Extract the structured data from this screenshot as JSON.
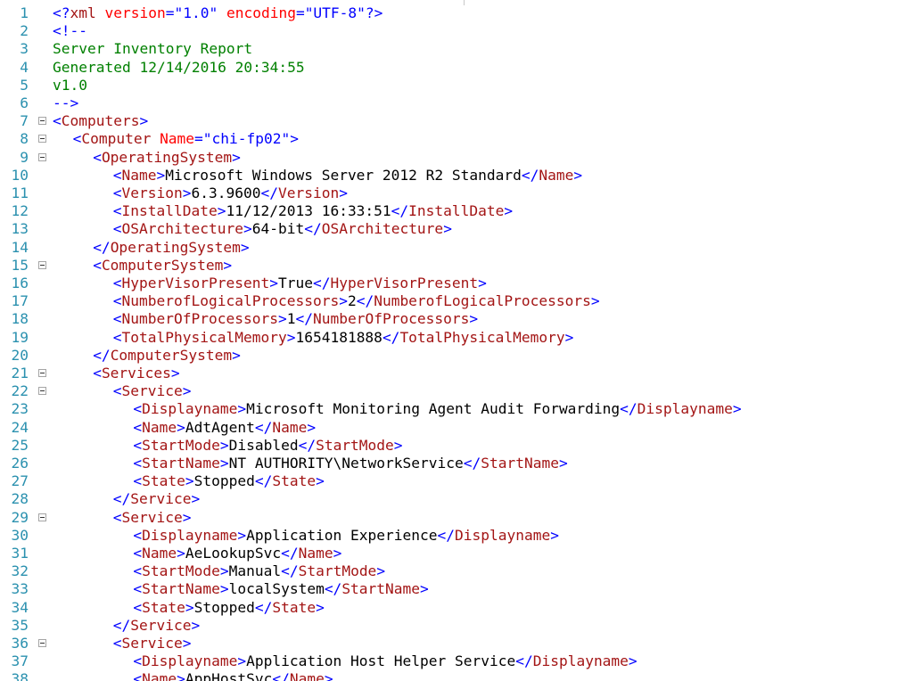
{
  "editor": {
    "colors": {
      "line_numbers": "#2b91af",
      "bracket": "#0000ff",
      "tag": "#a31515",
      "attribute": "#ff0000",
      "value": "#0000ff",
      "comment": "#008000",
      "text": "#000000"
    },
    "lines": [
      {
        "n": "1",
        "fold": false,
        "indent": 0,
        "tokens": [
          [
            "punct",
            "<?"
          ],
          [
            "tag",
            "xml"
          ],
          [
            "text",
            " "
          ],
          [
            "attr",
            "version"
          ],
          [
            "punct",
            "="
          ],
          [
            "value",
            "\"1.0\""
          ],
          [
            "text",
            " "
          ],
          [
            "attr",
            "encoding"
          ],
          [
            "punct",
            "="
          ],
          [
            "value",
            "\"UTF-8\""
          ],
          [
            "punct",
            "?>"
          ]
        ]
      },
      {
        "n": "2",
        "fold": false,
        "indent": 0,
        "tokens": [
          [
            "punct",
            "<!--"
          ]
        ]
      },
      {
        "n": "3",
        "fold": false,
        "indent": 0,
        "tokens": [
          [
            "comment",
            "Server Inventory Report"
          ]
        ]
      },
      {
        "n": "4",
        "fold": false,
        "indent": 0,
        "tokens": [
          [
            "comment",
            "Generated 12/14/2016 20:34:55"
          ]
        ]
      },
      {
        "n": "5",
        "fold": false,
        "indent": 0,
        "tokens": [
          [
            "comment",
            "v1.0"
          ]
        ]
      },
      {
        "n": "6",
        "fold": false,
        "indent": 0,
        "tokens": [
          [
            "punct",
            "-->"
          ]
        ]
      },
      {
        "n": "7",
        "fold": true,
        "indent": 0,
        "tokens": [
          [
            "bracket",
            "<"
          ],
          [
            "tag",
            "Computers"
          ],
          [
            "bracket",
            ">"
          ]
        ]
      },
      {
        "n": "8",
        "fold": true,
        "indent": 1,
        "tokens": [
          [
            "bracket",
            "<"
          ],
          [
            "tag",
            "Computer"
          ],
          [
            "text",
            " "
          ],
          [
            "attr",
            "Name"
          ],
          [
            "punct",
            "="
          ],
          [
            "value",
            "\"chi-fp02\""
          ],
          [
            "bracket",
            ">"
          ]
        ]
      },
      {
        "n": "9",
        "fold": true,
        "indent": 2,
        "tokens": [
          [
            "bracket",
            "<"
          ],
          [
            "tag",
            "OperatingSystem"
          ],
          [
            "bracket",
            ">"
          ]
        ]
      },
      {
        "n": "10",
        "fold": false,
        "indent": 3,
        "tokens": [
          [
            "bracket",
            "<"
          ],
          [
            "tag",
            "Name"
          ],
          [
            "bracket",
            ">"
          ],
          [
            "text",
            "Microsoft Windows Server 2012 R2 Standard"
          ],
          [
            "bracket",
            "</"
          ],
          [
            "tag",
            "Name"
          ],
          [
            "bracket",
            ">"
          ]
        ]
      },
      {
        "n": "11",
        "fold": false,
        "indent": 3,
        "tokens": [
          [
            "bracket",
            "<"
          ],
          [
            "tag",
            "Version"
          ],
          [
            "bracket",
            ">"
          ],
          [
            "text",
            "6.3.9600"
          ],
          [
            "bracket",
            "</"
          ],
          [
            "tag",
            "Version"
          ],
          [
            "bracket",
            ">"
          ]
        ]
      },
      {
        "n": "12",
        "fold": false,
        "indent": 3,
        "tokens": [
          [
            "bracket",
            "<"
          ],
          [
            "tag",
            "InstallDate"
          ],
          [
            "bracket",
            ">"
          ],
          [
            "text",
            "11/12/2013 16:33:51"
          ],
          [
            "bracket",
            "</"
          ],
          [
            "tag",
            "InstallDate"
          ],
          [
            "bracket",
            ">"
          ]
        ]
      },
      {
        "n": "13",
        "fold": false,
        "indent": 3,
        "tokens": [
          [
            "bracket",
            "<"
          ],
          [
            "tag",
            "OSArchitecture"
          ],
          [
            "bracket",
            ">"
          ],
          [
            "text",
            "64-bit"
          ],
          [
            "bracket",
            "</"
          ],
          [
            "tag",
            "OSArchitecture"
          ],
          [
            "bracket",
            ">"
          ]
        ]
      },
      {
        "n": "14",
        "fold": false,
        "indent": 2,
        "tokens": [
          [
            "bracket",
            "</"
          ],
          [
            "tag",
            "OperatingSystem"
          ],
          [
            "bracket",
            ">"
          ]
        ]
      },
      {
        "n": "15",
        "fold": true,
        "indent": 2,
        "tokens": [
          [
            "bracket",
            "<"
          ],
          [
            "tag",
            "ComputerSystem"
          ],
          [
            "bracket",
            ">"
          ]
        ]
      },
      {
        "n": "16",
        "fold": false,
        "indent": 3,
        "tokens": [
          [
            "bracket",
            "<"
          ],
          [
            "tag",
            "HyperVisorPresent"
          ],
          [
            "bracket",
            ">"
          ],
          [
            "text",
            "True"
          ],
          [
            "bracket",
            "</"
          ],
          [
            "tag",
            "HyperVisorPresent"
          ],
          [
            "bracket",
            ">"
          ]
        ]
      },
      {
        "n": "17",
        "fold": false,
        "indent": 3,
        "tokens": [
          [
            "bracket",
            "<"
          ],
          [
            "tag",
            "NumberofLogicalProcessors"
          ],
          [
            "bracket",
            ">"
          ],
          [
            "text",
            "2"
          ],
          [
            "bracket",
            "</"
          ],
          [
            "tag",
            "NumberofLogicalProcessors"
          ],
          [
            "bracket",
            ">"
          ]
        ]
      },
      {
        "n": "18",
        "fold": false,
        "indent": 3,
        "tokens": [
          [
            "bracket",
            "<"
          ],
          [
            "tag",
            "NumberOfProcessors"
          ],
          [
            "bracket",
            ">"
          ],
          [
            "text",
            "1"
          ],
          [
            "bracket",
            "</"
          ],
          [
            "tag",
            "NumberOfProcessors"
          ],
          [
            "bracket",
            ">"
          ]
        ]
      },
      {
        "n": "19",
        "fold": false,
        "indent": 3,
        "tokens": [
          [
            "bracket",
            "<"
          ],
          [
            "tag",
            "TotalPhysicalMemory"
          ],
          [
            "bracket",
            ">"
          ],
          [
            "text",
            "1654181888"
          ],
          [
            "bracket",
            "</"
          ],
          [
            "tag",
            "TotalPhysicalMemory"
          ],
          [
            "bracket",
            ">"
          ]
        ]
      },
      {
        "n": "20",
        "fold": false,
        "indent": 2,
        "tokens": [
          [
            "bracket",
            "</"
          ],
          [
            "tag",
            "ComputerSystem"
          ],
          [
            "bracket",
            ">"
          ]
        ]
      },
      {
        "n": "21",
        "fold": true,
        "indent": 2,
        "tokens": [
          [
            "bracket",
            "<"
          ],
          [
            "tag",
            "Services"
          ],
          [
            "bracket",
            ">"
          ]
        ]
      },
      {
        "n": "22",
        "fold": true,
        "indent": 3,
        "tokens": [
          [
            "bracket",
            "<"
          ],
          [
            "tag",
            "Service"
          ],
          [
            "bracket",
            ">"
          ]
        ]
      },
      {
        "n": "23",
        "fold": false,
        "indent": 4,
        "tokens": [
          [
            "bracket",
            "<"
          ],
          [
            "tag",
            "Displayname"
          ],
          [
            "bracket",
            ">"
          ],
          [
            "text",
            "Microsoft Monitoring Agent Audit Forwarding"
          ],
          [
            "bracket",
            "</"
          ],
          [
            "tag",
            "Displayname"
          ],
          [
            "bracket",
            ">"
          ]
        ]
      },
      {
        "n": "24",
        "fold": false,
        "indent": 4,
        "tokens": [
          [
            "bracket",
            "<"
          ],
          [
            "tag",
            "Name"
          ],
          [
            "bracket",
            ">"
          ],
          [
            "text",
            "AdtAgent"
          ],
          [
            "bracket",
            "</"
          ],
          [
            "tag",
            "Name"
          ],
          [
            "bracket",
            ">"
          ]
        ]
      },
      {
        "n": "25",
        "fold": false,
        "indent": 4,
        "tokens": [
          [
            "bracket",
            "<"
          ],
          [
            "tag",
            "StartMode"
          ],
          [
            "bracket",
            ">"
          ],
          [
            "text",
            "Disabled"
          ],
          [
            "bracket",
            "</"
          ],
          [
            "tag",
            "StartMode"
          ],
          [
            "bracket",
            ">"
          ]
        ]
      },
      {
        "n": "26",
        "fold": false,
        "indent": 4,
        "tokens": [
          [
            "bracket",
            "<"
          ],
          [
            "tag",
            "StartName"
          ],
          [
            "bracket",
            ">"
          ],
          [
            "text",
            "NT AUTHORITY\\NetworkService"
          ],
          [
            "bracket",
            "</"
          ],
          [
            "tag",
            "StartName"
          ],
          [
            "bracket",
            ">"
          ]
        ]
      },
      {
        "n": "27",
        "fold": false,
        "indent": 4,
        "tokens": [
          [
            "bracket",
            "<"
          ],
          [
            "tag",
            "State"
          ],
          [
            "bracket",
            ">"
          ],
          [
            "text",
            "Stopped"
          ],
          [
            "bracket",
            "</"
          ],
          [
            "tag",
            "State"
          ],
          [
            "bracket",
            ">"
          ]
        ]
      },
      {
        "n": "28",
        "fold": false,
        "indent": 3,
        "tokens": [
          [
            "bracket",
            "</"
          ],
          [
            "tag",
            "Service"
          ],
          [
            "bracket",
            ">"
          ]
        ]
      },
      {
        "n": "29",
        "fold": true,
        "indent": 3,
        "tokens": [
          [
            "bracket",
            "<"
          ],
          [
            "tag",
            "Service"
          ],
          [
            "bracket",
            ">"
          ]
        ]
      },
      {
        "n": "30",
        "fold": false,
        "indent": 4,
        "tokens": [
          [
            "bracket",
            "<"
          ],
          [
            "tag",
            "Displayname"
          ],
          [
            "bracket",
            ">"
          ],
          [
            "text",
            "Application Experience"
          ],
          [
            "bracket",
            "</"
          ],
          [
            "tag",
            "Displayname"
          ],
          [
            "bracket",
            ">"
          ]
        ]
      },
      {
        "n": "31",
        "fold": false,
        "indent": 4,
        "tokens": [
          [
            "bracket",
            "<"
          ],
          [
            "tag",
            "Name"
          ],
          [
            "bracket",
            ">"
          ],
          [
            "text",
            "AeLookupSvc"
          ],
          [
            "bracket",
            "</"
          ],
          [
            "tag",
            "Name"
          ],
          [
            "bracket",
            ">"
          ]
        ]
      },
      {
        "n": "32",
        "fold": false,
        "indent": 4,
        "tokens": [
          [
            "bracket",
            "<"
          ],
          [
            "tag",
            "StartMode"
          ],
          [
            "bracket",
            ">"
          ],
          [
            "text",
            "Manual"
          ],
          [
            "bracket",
            "</"
          ],
          [
            "tag",
            "StartMode"
          ],
          [
            "bracket",
            ">"
          ]
        ]
      },
      {
        "n": "33",
        "fold": false,
        "indent": 4,
        "tokens": [
          [
            "bracket",
            "<"
          ],
          [
            "tag",
            "StartName"
          ],
          [
            "bracket",
            ">"
          ],
          [
            "text",
            "localSystem"
          ],
          [
            "bracket",
            "</"
          ],
          [
            "tag",
            "StartName"
          ],
          [
            "bracket",
            ">"
          ]
        ]
      },
      {
        "n": "34",
        "fold": false,
        "indent": 4,
        "tokens": [
          [
            "bracket",
            "<"
          ],
          [
            "tag",
            "State"
          ],
          [
            "bracket",
            ">"
          ],
          [
            "text",
            "Stopped"
          ],
          [
            "bracket",
            "</"
          ],
          [
            "tag",
            "State"
          ],
          [
            "bracket",
            ">"
          ]
        ]
      },
      {
        "n": "35",
        "fold": false,
        "indent": 3,
        "tokens": [
          [
            "bracket",
            "</"
          ],
          [
            "tag",
            "Service"
          ],
          [
            "bracket",
            ">"
          ]
        ]
      },
      {
        "n": "36",
        "fold": true,
        "indent": 3,
        "tokens": [
          [
            "bracket",
            "<"
          ],
          [
            "tag",
            "Service"
          ],
          [
            "bracket",
            ">"
          ]
        ]
      },
      {
        "n": "37",
        "fold": false,
        "indent": 4,
        "tokens": [
          [
            "bracket",
            "<"
          ],
          [
            "tag",
            "Displayname"
          ],
          [
            "bracket",
            ">"
          ],
          [
            "text",
            "Application Host Helper Service"
          ],
          [
            "bracket",
            "</"
          ],
          [
            "tag",
            "Displayname"
          ],
          [
            "bracket",
            ">"
          ]
        ]
      },
      {
        "n": "38",
        "fold": false,
        "indent": 4,
        "tokens": [
          [
            "bracket",
            "<"
          ],
          [
            "tag",
            "Name"
          ],
          [
            "bracket",
            ">"
          ],
          [
            "text",
            "AppHostSvc"
          ],
          [
            "bracket",
            "</"
          ],
          [
            "tag",
            "Name"
          ],
          [
            "bracket",
            ">"
          ]
        ]
      }
    ]
  }
}
